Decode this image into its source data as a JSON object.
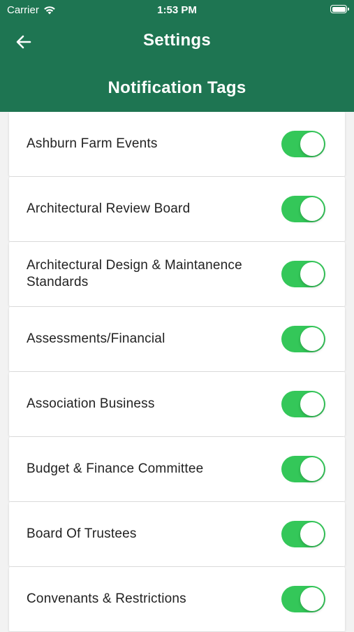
{
  "status_bar": {
    "carrier": "Carrier",
    "time": "1:53 PM"
  },
  "header": {
    "title": "Settings",
    "subtitle": "Notification Tags",
    "back_icon": "arrow-left-icon",
    "background_color": "#1e7552"
  },
  "tags": [
    {
      "label": "Ashburn Farm Events",
      "enabled": true
    },
    {
      "label": "Architectural Review Board",
      "enabled": true
    },
    {
      "label": "Architectural Design & Maintanence Standards",
      "enabled": true
    },
    {
      "label": "Assessments/Financial",
      "enabled": true
    },
    {
      "label": "Association Business",
      "enabled": true
    },
    {
      "label": "Budget & Finance Committee",
      "enabled": true
    },
    {
      "label": "Board Of Trustees",
      "enabled": true
    },
    {
      "label": "Convenants & Restrictions",
      "enabled": true
    }
  ],
  "toggle_on_color": "#34c759"
}
